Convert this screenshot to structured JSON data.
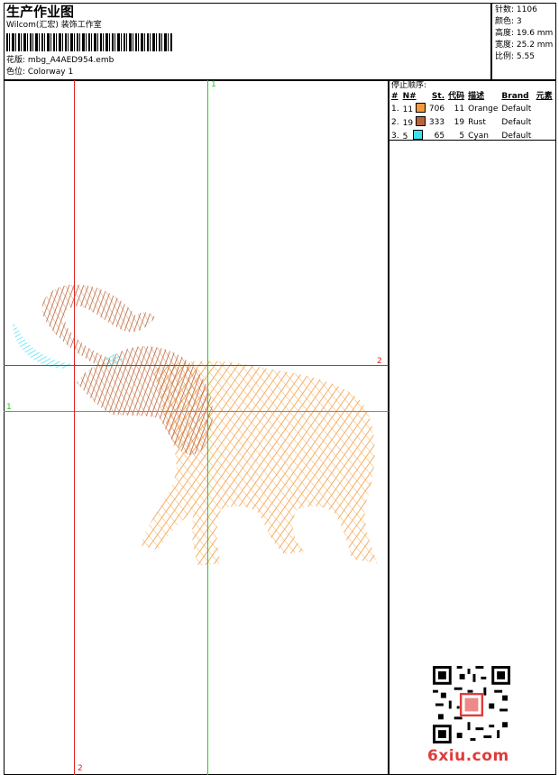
{
  "header": {
    "title": "生产作业图",
    "company": "Wilcom(汇宏) 装饰工作室",
    "design_label": "花版: mbg_A4AED954.emb",
    "colorway_label": "色位:  Colorway 1"
  },
  "stats": {
    "stitches": "针数: 1106",
    "colors": "颜色: 3",
    "height": "高度: 19.6 mm",
    "width": "宽度: 25.2 mm",
    "scale": "比例: 5.55"
  },
  "stop_sequence": {
    "title": "停止顺序:",
    "headers": [
      "#",
      "N#",
      "St.",
      "代码",
      "描述",
      "Brand",
      "元素"
    ],
    "rows": [
      {
        "num": "1.",
        "n": "11",
        "swatch": "#f49a3e",
        "st": "706",
        "code": "11",
        "desc": "Orange",
        "brand": "Default"
      },
      {
        "num": "2.",
        "n": "19",
        "swatch": "#b9643a",
        "st": "333",
        "code": "19",
        "desc": "Rust",
        "brand": "Default"
      },
      {
        "num": "3.",
        "n": "5",
        "swatch": "#3ee0f0",
        "st": "65",
        "code": "5",
        "desc": "Cyan",
        "brand": "Default"
      }
    ]
  },
  "guides": {
    "green_v_label": "1",
    "green_h_label": "1",
    "red_h_label": "2",
    "red_v_label": "2",
    "green": "#22cc22",
    "red": "#dd2222"
  },
  "watermark": "6xiu.com"
}
